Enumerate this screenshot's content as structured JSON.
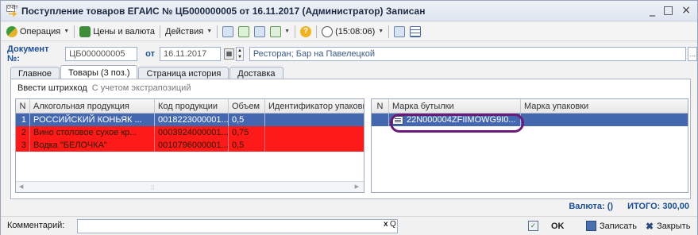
{
  "window": {
    "title": "Поступление товаров ЕГАИС № ЦБ000000005 от 16.11.2017 (Администратор) Записан",
    "app_icon_text": "ОЧЕТ",
    "minimize": "_",
    "maximize": "□",
    "close": "×"
  },
  "toolbar": {
    "operation": "Операция",
    "prices": "Цены и валюта",
    "actions": "Действия",
    "help": "?",
    "time": "(15:08:06)"
  },
  "document": {
    "number_label": "Документ №:",
    "number": "ЦБ000000005",
    "date_label": "от",
    "date": "16.11.2017",
    "place": "Ресторан; Бар на Павелецкой",
    "ellipsis": "..."
  },
  "tabs": [
    {
      "label": "Главное"
    },
    {
      "label": "Товары (3 поз.)"
    },
    {
      "label": "Страница история"
    },
    {
      "label": "Доставка"
    }
  ],
  "subbar": {
    "barcode": "Ввести штрихкод",
    "extrapolation": "С учетом экстрапозиций"
  },
  "left_table": {
    "columns": [
      "N",
      "Алкогольная продукция",
      "Код продукции",
      "Объем",
      "Идентификатор упаковки"
    ],
    "rows": [
      {
        "n": "1",
        "product": "РОССИЙСКИЙ КОНЬЯК ...",
        "code": "0018223000001...",
        "volume": "0,5",
        "pack": ""
      },
      {
        "n": "2",
        "product": "Вино столовое сухое кр...",
        "code": "0003924000001...",
        "volume": "0,75",
        "pack": ""
      },
      {
        "n": "3",
        "product": "Водка \"БЕЛОЧКА\"",
        "code": "0010796000001...",
        "volume": "0,5",
        "pack": ""
      }
    ]
  },
  "right_table": {
    "columns": [
      "N",
      "Марка бутылки",
      "Марка упаковки"
    ],
    "rows": [
      {
        "n": "",
        "bottle_mark": "22N000004ZFIIMOWG9I0...",
        "pack_mark": ""
      }
    ]
  },
  "totals": {
    "currency": "Валюта: ()",
    "total": "ИТОГО: 300,00"
  },
  "bottom": {
    "comment_label": "Комментарий:",
    "clear": "x",
    "search": "Q",
    "ok": "OK",
    "save": "Записать",
    "close": "Закрыть"
  },
  "colors": {
    "selected_row": "#4468b0",
    "error_row": "#ff1a1a",
    "highlight_ring": "#6b1a7a",
    "label_blue": "#1b4f9c"
  }
}
